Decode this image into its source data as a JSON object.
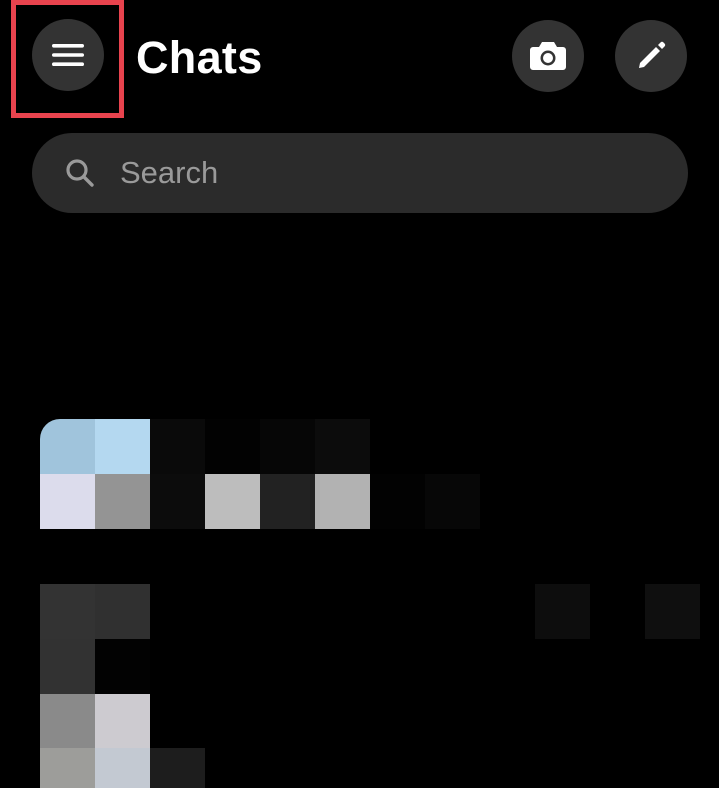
{
  "header": {
    "title": "Chats"
  },
  "search": {
    "placeholder": "Search"
  },
  "icons": {
    "menu": "hamburger-menu-icon",
    "camera": "camera-icon",
    "compose": "pencil-icon",
    "search": "magnifier-icon"
  },
  "colors": {
    "background": "#000000",
    "button_bg": "#333333",
    "search_bg": "#2b2b2b",
    "highlight": "#e8434e",
    "placeholder": "#9a9a9a"
  },
  "chat_rows": [
    {
      "pixels": [
        {
          "c": "#a0c4dc"
        },
        {
          "c": "#b4d8f0"
        },
        {
          "c": "#0a0a0a"
        },
        {
          "c": "#020202"
        },
        {
          "c": "#060606"
        },
        {
          "c": "#0c0c0c"
        },
        {
          "c": "#dcdcec"
        },
        {
          "c": "#949494"
        },
        {
          "c": "#0c0c0c"
        },
        {
          "c": "#bdbdbd"
        },
        {
          "c": "#222222"
        },
        {
          "c": "#b2b2b2"
        },
        {
          "c": "#020202"
        },
        {
          "c": "#070707"
        }
      ]
    },
    {
      "pixels": [
        {
          "c": "#333333"
        },
        {
          "c": "#303030"
        },
        {
          "c": "#0d0d0d"
        },
        {
          "c": "#0f0f0f"
        },
        {
          "c": "#323232"
        },
        {
          "c": "#020202"
        },
        {
          "c": "#8a8a8a"
        },
        {
          "c": "#cdcbd0"
        },
        {
          "c": "#9d9d9a"
        },
        {
          "c": "#c3c9d2"
        },
        {
          "c": "#1d1d1d"
        }
      ]
    }
  ]
}
